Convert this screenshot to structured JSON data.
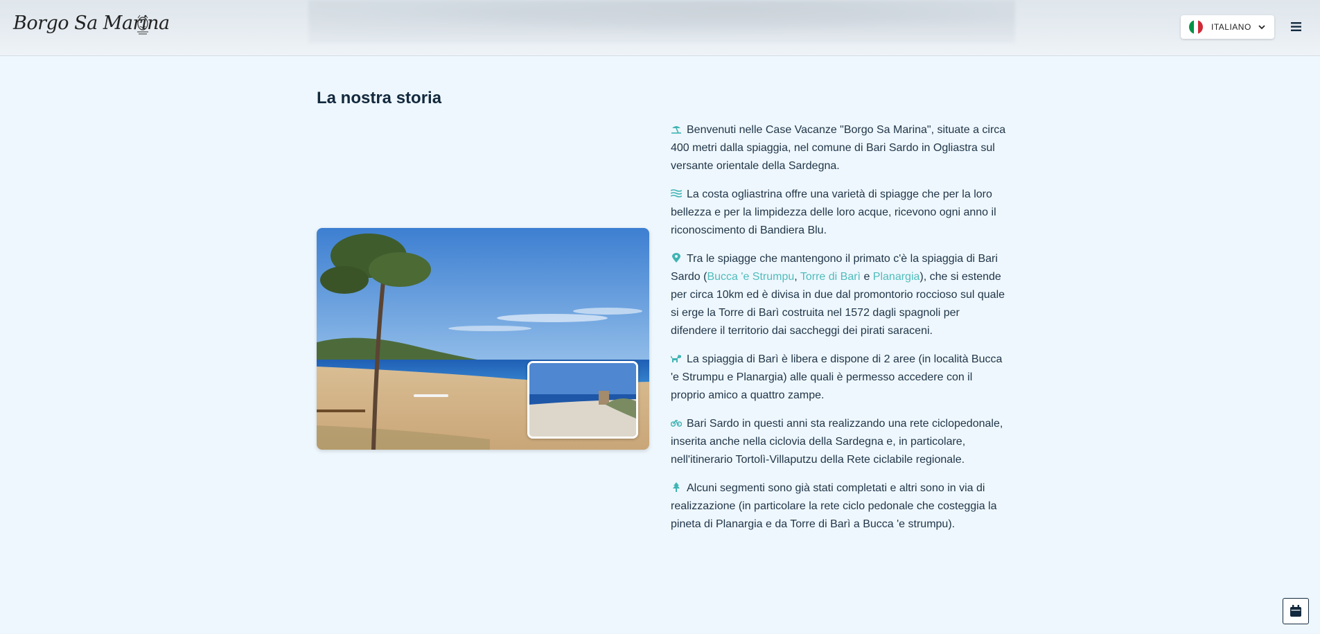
{
  "header": {
    "logo_text": "Borgo Sa Marina",
    "language": {
      "selected": "ITALIANO",
      "flag_colors": [
        "#009246",
        "#ffffff",
        "#ce2b37"
      ]
    },
    "menu_icon": "hamburger-icon"
  },
  "main": {
    "title": "La nostra storia",
    "paragraphs": [
      {
        "icon": "umbrella-beach-icon",
        "text": "Benvenuti nelle Case Vacanze \"Borgo Sa Marina\", situate a circa 400 metri dalla spiaggia, nel comune di Bari Sardo in Ogliastra sul versante orientale della Sardegna."
      },
      {
        "icon": "water-waves-icon",
        "text": "La costa ogliastrina offre una varietà di spiagge che per la loro bellezza e per la limpidezza delle loro acque, ricevono ogni anno il riconoscimento di Bandiera Blu."
      },
      {
        "icon": "location-pin-icon",
        "text_before": "Tra le spiagge che mantengono il primato c'è la spiaggia di Bari Sardo (",
        "link1": "Bucca 'e Strumpu",
        "sep1": ", ",
        "link2": "Torre di Barì",
        "sep2": " e ",
        "link3": "Planargia",
        "text_after": "), che si estende per circa 10km ed è divisa in due dal promontorio roccioso sul quale si erge la Torre di Barì costruita nel 1572 dagli spagnoli per difendere il territorio dai saccheggi dei pirati saraceni."
      },
      {
        "icon": "dog-icon",
        "text": "La spiaggia di Barì è libera e dispone di 2 aree (in località Bucca 'e Strumpu e Planargia) alle quali è permesso accedere con il proprio amico a quattro zampe."
      },
      {
        "icon": "bicycle-icon",
        "text": "Bari Sardo in questi anni sta realizzando una rete ciclopedonale, inserita anche nella ciclovia della Sardegna e, in particolare, nell'itinerario Tortolì-Villaputzu della Rete ciclabile regionale."
      },
      {
        "icon": "tree-icon",
        "text": "Alcuni segmenti sono già stati completati e altri sono in via di realizzazione (in particolare la rete ciclo pedonale che costeggia la pineta di Planargia e da Torre di Barì a Bucca 'e strumpu)."
      }
    ]
  },
  "floating": {
    "calendar_icon": "calendar-icon"
  },
  "colors": {
    "background": "#eef7fd",
    "accent": "#4fbcbc",
    "text": "#1f3447",
    "heading": "#13293d"
  }
}
